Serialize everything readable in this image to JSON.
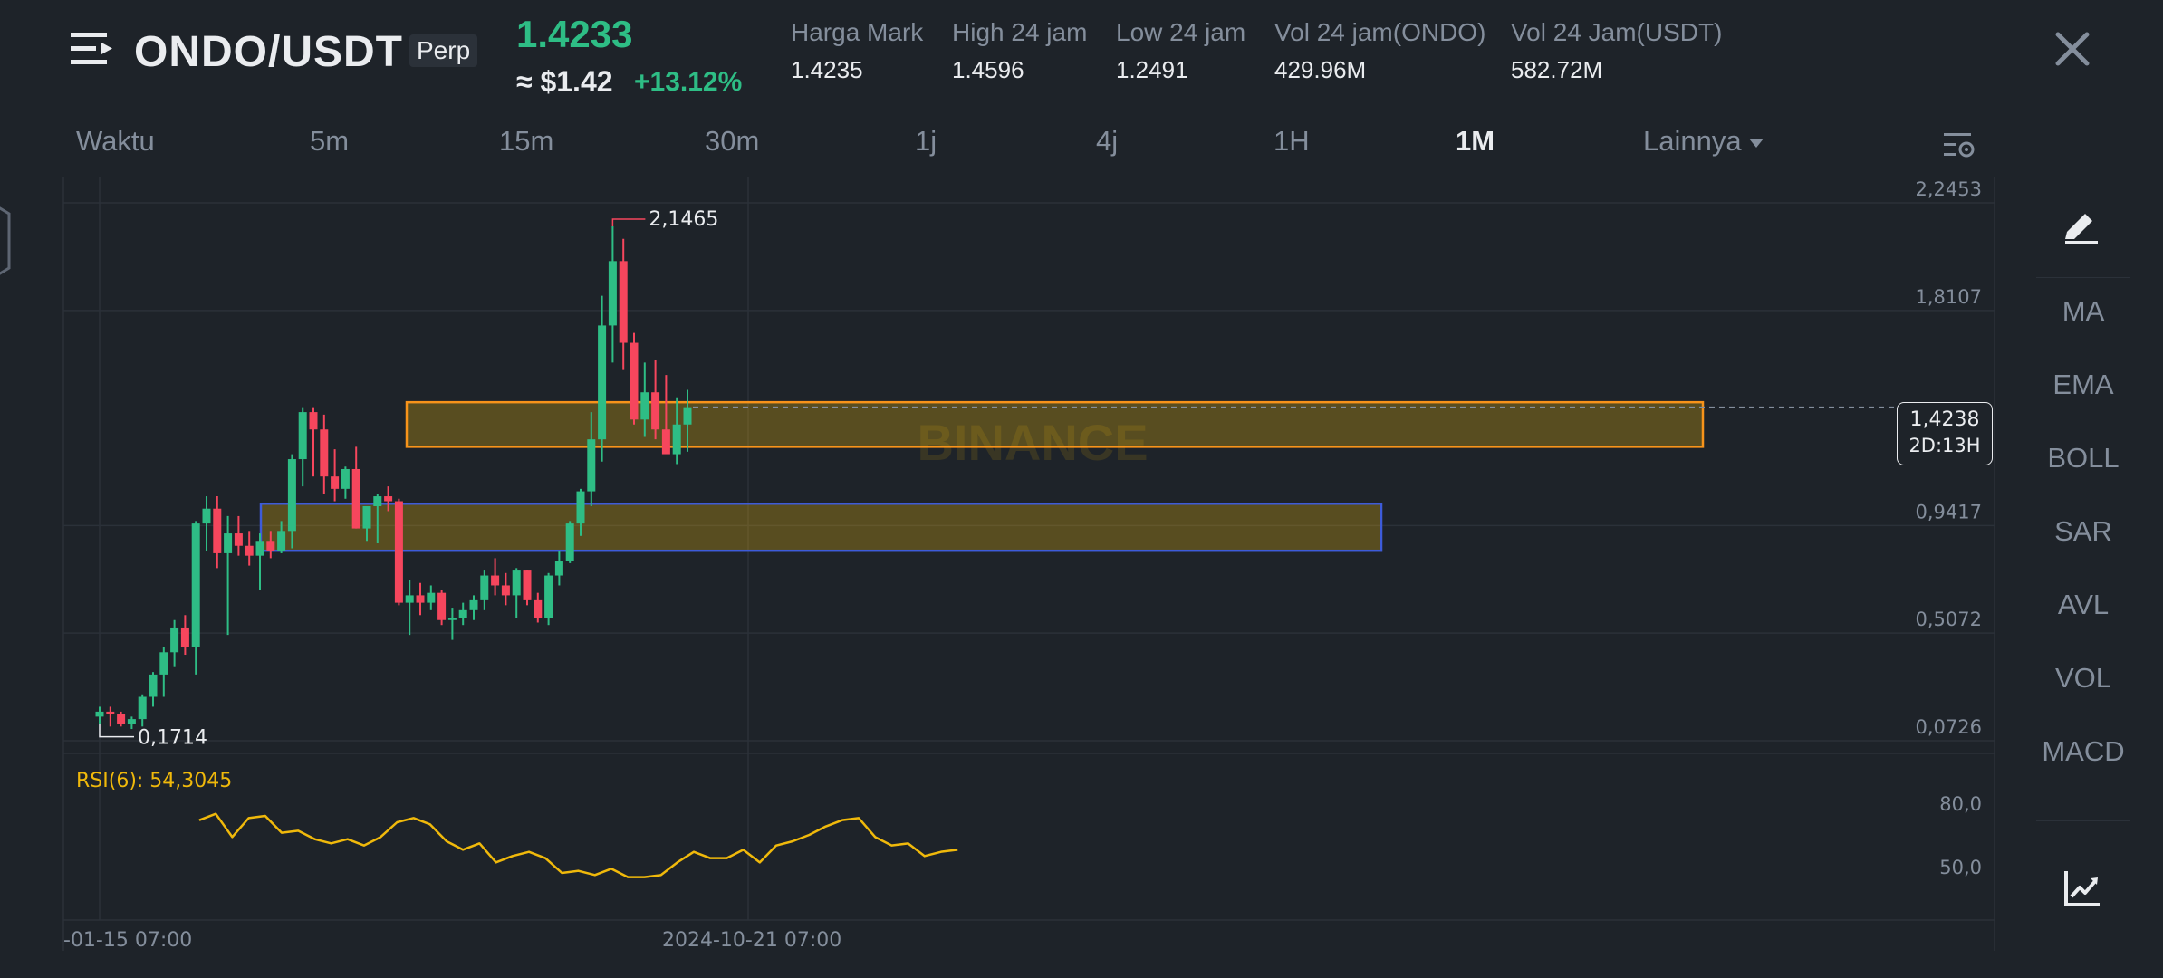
{
  "header": {
    "pair": "ONDO/USDT",
    "contract_type": "Perp",
    "last_price": "1.4233",
    "usd_price": "≈ $1.42",
    "change_pct": "+13.12%",
    "stats": [
      {
        "label": "Harga Mark",
        "value": "1.4235"
      },
      {
        "label": "High 24 jam",
        "value": "1.4596"
      },
      {
        "label": "Low 24 jam",
        "value": "1.2491"
      },
      {
        "label": "Vol 24 jam(ONDO)",
        "value": "429.96M"
      },
      {
        "label": "Vol 24 Jam(USDT)",
        "value": "582.72M"
      }
    ]
  },
  "intervals": [
    "Waktu",
    "5m",
    "15m",
    "30m",
    "1j",
    "4j",
    "1H",
    "1M",
    "Lainnya"
  ],
  "active_interval": "1M",
  "price_axis": [
    "2,2453",
    "1,8107",
    "0,9417",
    "0,5072",
    "0,0726"
  ],
  "markers": {
    "high": "2,1465",
    "low": "0,1714"
  },
  "current_price_tag": {
    "price": "1,4238",
    "countdown": "2D:13H"
  },
  "watermark": "BINANCE",
  "rsi": {
    "label": "RSI(6): 54,3045",
    "axis": [
      "80,0",
      "50,0"
    ]
  },
  "time_axis": [
    "-01-15 07:00",
    "2024-10-21 07:00"
  ],
  "toolbar": {
    "indicators": [
      "MA",
      "EMA",
      "BOLL",
      "SAR",
      "AVL",
      "VOL",
      "MACD"
    ]
  },
  "colors": {
    "background": "#1e2329",
    "up": "#2ebd85",
    "down": "#f6465d",
    "rsi_line": "#f0b90b",
    "zone_orange": "#f7931a",
    "zone_blue": "#3d5bd9",
    "text_muted": "#848e9c"
  },
  "chart_data": {
    "type": "candlestick",
    "ylim": [
      0.0726,
      2.2453
    ],
    "candles": [
      [
        0.17,
        0.21,
        0.14,
        0.19
      ],
      [
        0.19,
        0.21,
        0.13,
        0.18
      ],
      [
        0.18,
        0.19,
        0.13,
        0.14
      ],
      [
        0.14,
        0.17,
        0.12,
        0.16
      ],
      [
        0.16,
        0.26,
        0.13,
        0.25
      ],
      [
        0.25,
        0.35,
        0.21,
        0.34
      ],
      [
        0.34,
        0.45,
        0.25,
        0.43
      ],
      [
        0.43,
        0.56,
        0.37,
        0.53
      ],
      [
        0.53,
        0.58,
        0.42,
        0.45
      ],
      [
        0.45,
        0.96,
        0.34,
        0.95
      ],
      [
        0.95,
        1.06,
        0.84,
        1.01
      ],
      [
        1.01,
        1.06,
        0.77,
        0.83
      ],
      [
        0.83,
        0.98,
        0.5,
        0.91
      ],
      [
        0.91,
        0.98,
        0.82,
        0.86
      ],
      [
        0.86,
        0.92,
        0.78,
        0.82
      ],
      [
        0.82,
        0.91,
        0.68,
        0.88
      ],
      [
        0.88,
        0.92,
        0.81,
        0.84
      ],
      [
        0.84,
        0.96,
        0.83,
        0.92
      ],
      [
        0.92,
        1.23,
        0.85,
        1.21
      ],
      [
        1.21,
        1.42,
        1.1,
        1.4
      ],
      [
        1.4,
        1.42,
        1.14,
        1.33
      ],
      [
        1.33,
        1.39,
        1.07,
        1.14
      ],
      [
        1.14,
        1.25,
        1.04,
        1.09
      ],
      [
        1.09,
        1.18,
        1.05,
        1.17
      ],
      [
        1.17,
        1.26,
        0.93,
        0.93
      ],
      [
        0.93,
        1.01,
        0.88,
        1.02
      ],
      [
        1.02,
        1.07,
        0.87,
        1.06
      ],
      [
        1.06,
        1.1,
        1.0,
        1.04
      ],
      [
        1.04,
        1.05,
        0.62,
        0.63
      ],
      [
        0.63,
        0.72,
        0.5,
        0.66
      ],
      [
        0.66,
        0.71,
        0.58,
        0.63
      ],
      [
        0.63,
        0.7,
        0.6,
        0.67
      ],
      [
        0.67,
        0.68,
        0.54,
        0.56
      ],
      [
        0.56,
        0.61,
        0.48,
        0.57
      ],
      [
        0.57,
        0.63,
        0.54,
        0.6
      ],
      [
        0.6,
        0.66,
        0.56,
        0.64
      ],
      [
        0.64,
        0.76,
        0.6,
        0.74
      ],
      [
        0.74,
        0.81,
        0.66,
        0.7
      ],
      [
        0.7,
        0.75,
        0.62,
        0.66
      ],
      [
        0.66,
        0.77,
        0.57,
        0.76
      ],
      [
        0.76,
        0.76,
        0.62,
        0.64
      ],
      [
        0.64,
        0.67,
        0.55,
        0.57
      ],
      [
        0.57,
        0.75,
        0.54,
        0.74
      ],
      [
        0.74,
        0.84,
        0.7,
        0.8
      ],
      [
        0.8,
        0.96,
        0.79,
        0.95
      ],
      [
        0.95,
        1.09,
        0.9,
        1.08
      ],
      [
        1.08,
        1.4,
        1.02,
        1.29
      ],
      [
        1.29,
        1.87,
        1.2,
        1.75
      ],
      [
        1.75,
        2.15,
        1.6,
        2.01
      ],
      [
        2.01,
        2.1,
        1.57,
        1.68
      ],
      [
        1.68,
        1.72,
        1.35,
        1.37
      ],
      [
        1.37,
        1.6,
        1.3,
        1.48
      ],
      [
        1.48,
        1.61,
        1.29,
        1.33
      ],
      [
        1.33,
        1.55,
        1.25,
        1.23
      ],
      [
        1.23,
        1.46,
        1.19,
        1.35
      ],
      [
        1.35,
        1.49,
        1.24,
        1.42
      ]
    ],
    "zones": [
      {
        "top": 1.44,
        "bottom": 1.26,
        "color": "orange"
      },
      {
        "top": 1.03,
        "bottom": 0.84,
        "color": "blue"
      }
    ],
    "rsi_values": [
      72,
      75,
      64,
      73,
      74,
      66,
      67,
      63,
      61,
      63,
      60,
      64,
      71,
      73,
      70,
      62,
      58,
      61,
      52,
      55,
      57,
      54,
      47,
      48,
      46,
      49,
      45,
      45,
      46,
      52,
      57,
      54,
      54,
      58,
      52,
      60,
      62,
      65,
      69,
      72,
      73,
      64,
      60,
      61,
      55,
      57,
      58
    ]
  }
}
